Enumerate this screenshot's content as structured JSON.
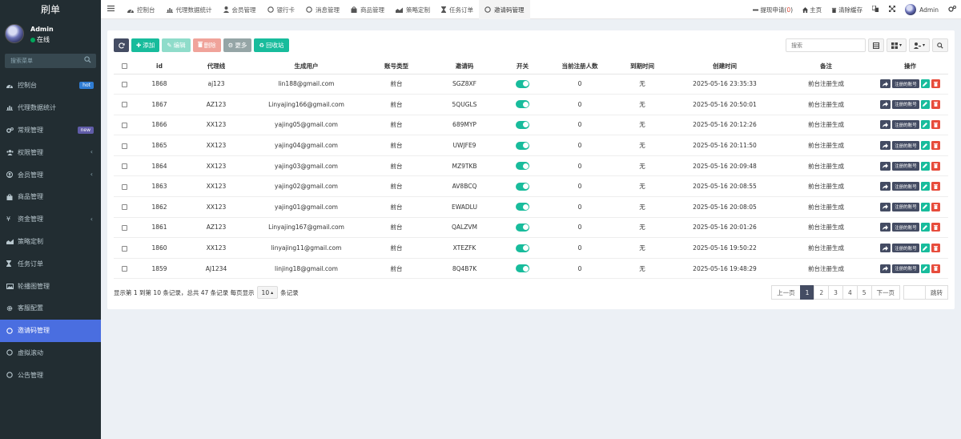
{
  "sidebar": {
    "brand": "刷单",
    "user": {
      "name": "Admin",
      "status": "在线"
    },
    "search_placeholder": "搜索菜单",
    "items": [
      {
        "label": "控制台",
        "icon": "dashboard-icon",
        "badge": "hot"
      },
      {
        "label": "代理数据统计",
        "icon": "bar-chart-icon"
      },
      {
        "label": "常规管理",
        "icon": "cogs-icon",
        "badge": "new"
      },
      {
        "label": "权限管理",
        "icon": "group-icon",
        "chevron": "‹"
      },
      {
        "label": "会员管理",
        "icon": "user-circle-icon",
        "chevron": "‹"
      },
      {
        "label": "商品管理",
        "icon": "shopping-bag-icon"
      },
      {
        "label": "资金管理",
        "icon": "yen-icon",
        "chevron": "‹"
      },
      {
        "label": "策略定制",
        "icon": "area-chart-icon"
      },
      {
        "label": "任务订单",
        "icon": "hourglass-icon"
      },
      {
        "label": "轮播图管理",
        "icon": "image-icon"
      },
      {
        "label": "客服配置",
        "icon": "gear-icon"
      },
      {
        "label": "邀请码管理",
        "icon": "circle-icon",
        "active": true
      },
      {
        "label": "虚拟滚动",
        "icon": "circle-icon"
      },
      {
        "label": "公告管理",
        "icon": "circle-icon"
      }
    ]
  },
  "topbar": {
    "tabs": [
      {
        "label": "控制台",
        "icon": "dashboard-icon"
      },
      {
        "label": "代理数据统计",
        "icon": "bar-chart-icon"
      },
      {
        "label": "会员管理",
        "icon": "user-icon"
      },
      {
        "label": "银行卡",
        "icon": "circle-icon"
      },
      {
        "label": "消息管理",
        "icon": "circle-icon"
      },
      {
        "label": "商品管理",
        "icon": "shopping-bag-icon"
      },
      {
        "label": "策略定制",
        "icon": "area-chart-icon"
      },
      {
        "label": "任务订单",
        "icon": "hourglass-icon"
      },
      {
        "label": "邀请码管理",
        "icon": "circle-icon",
        "active": true
      }
    ],
    "withdraw_label": "提现申请(",
    "withdraw_count": "0",
    "withdraw_close": ")",
    "home_label": "主页",
    "clear_cache_label": "清除缓存",
    "admin_label": "Admin"
  },
  "toolbar": {
    "add": "添加",
    "edit": "编辑",
    "delete": "删除",
    "more": "更多",
    "recycle": "回收站",
    "search_placeholder": "搜索"
  },
  "table": {
    "columns": [
      "id",
      "代理线",
      "生成用户",
      "账号类型",
      "邀请码",
      "开关",
      "当前注册人数",
      "到期时间",
      "创建时间",
      "备注",
      "操作"
    ],
    "account_btn": "注册的账号",
    "rows": [
      {
        "id": "1868",
        "line": "aj123",
        "user": "lin188@gmail.com",
        "type": "前台",
        "code": "SGZ8XF",
        "count": "0",
        "expire": "无",
        "created": "2025-05-16 23:35:33",
        "note": "前台注册生成"
      },
      {
        "id": "1867",
        "line": "AZ123",
        "user": "Linyajing166@gmail.com",
        "type": "前台",
        "code": "5QUGLS",
        "count": "0",
        "expire": "无",
        "created": "2025-05-16 20:50:01",
        "note": "前台注册生成"
      },
      {
        "id": "1866",
        "line": "XX123",
        "user": "yajing05@gmail.com",
        "type": "前台",
        "code": "689MYP",
        "count": "0",
        "expire": "无",
        "created": "2025-05-16 20:12:26",
        "note": "前台注册生成"
      },
      {
        "id": "1865",
        "line": "XX123",
        "user": "yajing04@gmail.com",
        "type": "前台",
        "code": "UWJFE9",
        "count": "0",
        "expire": "无",
        "created": "2025-05-16 20:11:50",
        "note": "前台注册生成"
      },
      {
        "id": "1864",
        "line": "XX123",
        "user": "yajing03@gmail.com",
        "type": "前台",
        "code": "MZ9TKB",
        "count": "0",
        "expire": "无",
        "created": "2025-05-16 20:09:48",
        "note": "前台注册生成"
      },
      {
        "id": "1863",
        "line": "XX123",
        "user": "yajing02@gmail.com",
        "type": "前台",
        "code": "AV8BCQ",
        "count": "0",
        "expire": "无",
        "created": "2025-05-16 20:08:55",
        "note": "前台注册生成"
      },
      {
        "id": "1862",
        "line": "XX123",
        "user": "yajing01@gmail.com",
        "type": "前台",
        "code": "EWADLU",
        "count": "0",
        "expire": "无",
        "created": "2025-05-16 20:08:05",
        "note": "前台注册生成"
      },
      {
        "id": "1861",
        "line": "AZ123",
        "user": "Linyajing167@gmail.com",
        "type": "前台",
        "code": "QALZVM",
        "count": "0",
        "expire": "无",
        "created": "2025-05-16 20:01:26",
        "note": "前台注册生成"
      },
      {
        "id": "1860",
        "line": "XX123",
        "user": "linyajing11@gmail.com",
        "type": "前台",
        "code": "XTEZFK",
        "count": "0",
        "expire": "无",
        "created": "2025-05-16 19:50:22",
        "note": "前台注册生成"
      },
      {
        "id": "1859",
        "line": "AJ1234",
        "user": "linjing18@gmail.com",
        "type": "前台",
        "code": "8Q4B7K",
        "count": "0",
        "expire": "无",
        "created": "2025-05-16 19:48:29",
        "note": "前台注册生成"
      }
    ]
  },
  "footer": {
    "info_prefix": "显示第 1 到第 10 条记录，总共 47 条记录 每页显示",
    "page_size": "10",
    "info_suffix": "条记录",
    "prev": "上一页",
    "pages": [
      "1",
      "2",
      "3",
      "4",
      "5"
    ],
    "active_page": "1",
    "next": "下一页",
    "jump": "跳转"
  },
  "colors": {
    "sidebar_bg": "#222d32",
    "active_menu": "#4a6ee0",
    "primary_dark": "#444c63",
    "success": "#18bc9c",
    "danger": "#e74c3c"
  }
}
